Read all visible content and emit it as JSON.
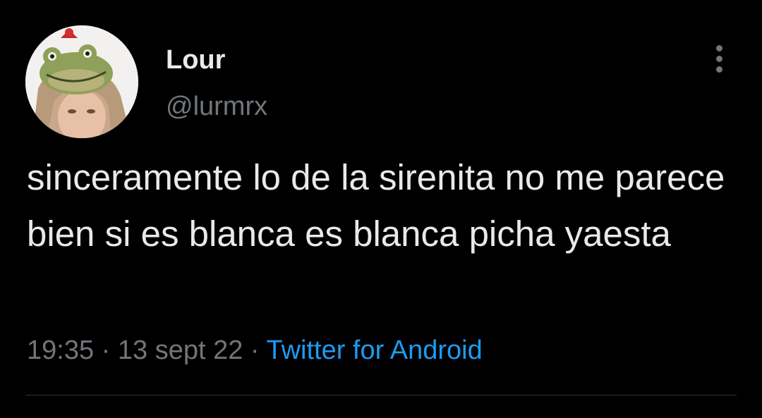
{
  "tweet": {
    "author": {
      "name": "Lour",
      "handle": "@lurmrx",
      "avatar_icon": "profile-photo-with-frog-hat"
    },
    "text": "sinceramente lo de la sirenita no me parece bien si es blanca es blanca picha yaesta",
    "time": "19:35",
    "separator": "·",
    "date": "13 sept 22",
    "source": "Twitter for Android",
    "more_icon": "more-options-icon"
  },
  "colors": {
    "background": "#000000",
    "text_primary": "#e7e9ea",
    "text_secondary": "#71767b",
    "link": "#1d9bf0",
    "divider": "#2f3336"
  }
}
